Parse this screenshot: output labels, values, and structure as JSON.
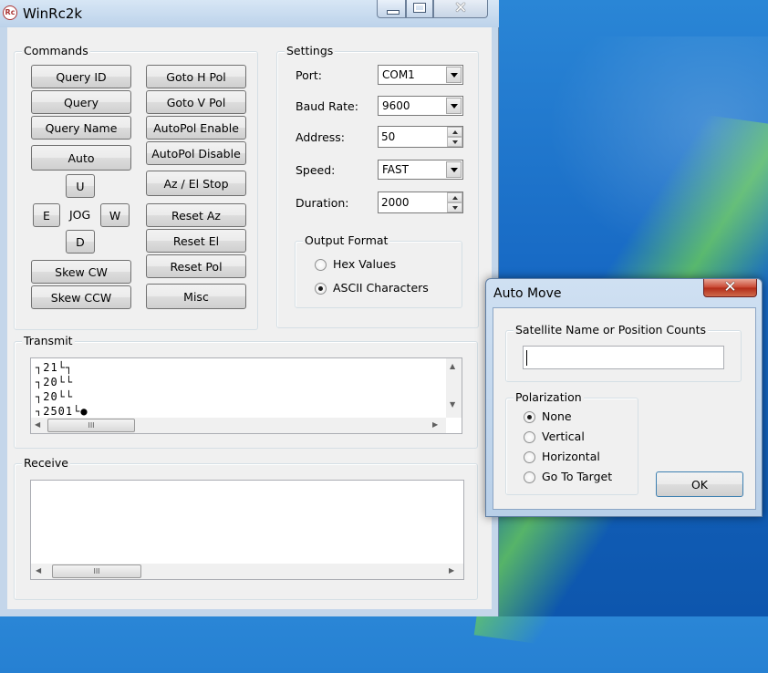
{
  "main_window": {
    "title": "WinRc2k",
    "icon_label": "Rc",
    "caption_buttons": {
      "minimize": "minimize-icon",
      "maximize": "maximize-icon",
      "close": "close-icon"
    }
  },
  "commands": {
    "label": "Commands",
    "left_buttons": [
      "Query ID",
      "Query",
      "Query Name",
      "Auto"
    ],
    "jog": {
      "up": "U",
      "left": "E",
      "center": "JOG",
      "right": "W",
      "down": "D"
    },
    "skew_buttons": [
      "Skew CW",
      "Skew CCW"
    ],
    "right_buttons": [
      "Goto H Pol",
      "Goto V Pol",
      "AutoPol Enable",
      "AutoPol Disable",
      "Az / El Stop",
      "Reset Az",
      "Reset El",
      "Reset Pol",
      "Misc"
    ]
  },
  "settings": {
    "label": "Settings",
    "port": {
      "label": "Port:",
      "value": "COM1"
    },
    "baud_rate": {
      "label": "Baud Rate:",
      "value": "9600"
    },
    "address": {
      "label": "Address:",
      "value": "50"
    },
    "speed": {
      "label": "Speed:",
      "value": "FAST"
    },
    "duration": {
      "label": "Duration:",
      "value": "2000"
    },
    "output_format": {
      "label": "Output Format",
      "options": [
        "Hex Values",
        "ASCII Characters"
      ],
      "selected": "ASCII Characters"
    }
  },
  "transmit": {
    "label": "Transmit",
    "lines": [
      "┐21└┐",
      "┐20└└",
      "┐20└└",
      "┐2501└●"
    ]
  },
  "receive": {
    "label": "Receive",
    "lines": []
  },
  "auto_move": {
    "title": "Auto Move",
    "satellite_group_label": "Satellite Name or Position Counts",
    "satellite_input_value": "",
    "polarization": {
      "label": "Polarization",
      "options": [
        "None",
        "Vertical",
        "Horizontal",
        "Go To Target"
      ],
      "selected": "None"
    },
    "ok_label": "OK"
  },
  "scroll_thumb_glyph": "III"
}
